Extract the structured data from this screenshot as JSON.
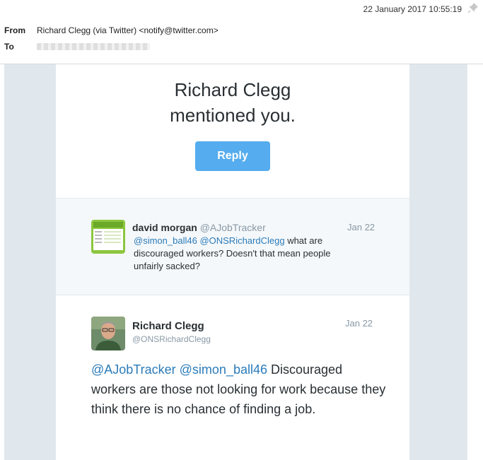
{
  "email": {
    "date": "22 January 2017 10:55:19",
    "from_label": "From",
    "from_value": "Richard Clegg (via Twitter) <notify@twitter.com>",
    "to_label": "To",
    "pin_icon": "pin-icon"
  },
  "notification": {
    "headline_line1": "Richard Clegg",
    "headline_line2": "mentioned you.",
    "reply_label": "Reply"
  },
  "quoted_tweet": {
    "name": "david morgan",
    "handle": "@AJobTracker",
    "date": "Jan 22",
    "mention1": "@simon_ball46",
    "mention2": "@ONSRichardClegg",
    "text": " what are discouraged workers? Doesn't that mean people unfairly sacked?"
  },
  "mention_tweet": {
    "name": "Richard Clegg",
    "handle": "@ONSRichardClegg",
    "date": "Jan 22",
    "mention1": "@AJobTracker",
    "mention2": "@simon_ball46",
    "text": " Discouraged workers are those not looking for work because they think there is no chance of finding a job."
  },
  "colors": {
    "accent": "#55acee",
    "link": "#2b7bb9",
    "muted": "#8899a6",
    "text": "#292f33",
    "page_bg": "#e1e8ed"
  }
}
